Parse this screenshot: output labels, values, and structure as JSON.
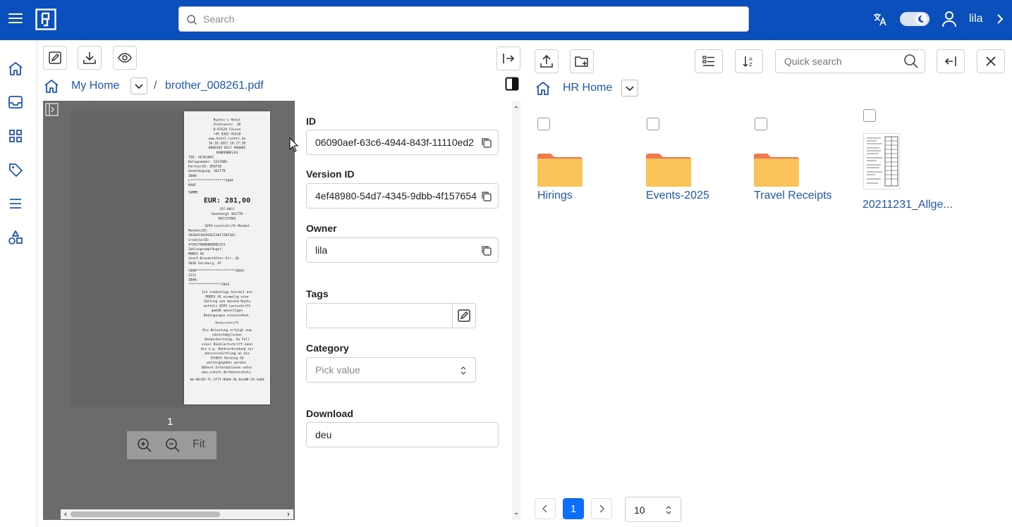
{
  "header": {
    "search_placeholder": "Search",
    "username": "lila"
  },
  "left_pane": {
    "breadcrumb": {
      "home": "My Home",
      "separator": "/",
      "file": "brother_008261.pdf"
    },
    "viewer": {
      "page_number": "1",
      "fit_label": "Fit"
    },
    "metadata": {
      "id_label": "ID",
      "id_value": "06090aef-63c6-4944-843f-11110ed2",
      "version_label": "Version ID",
      "version_value": "4ef48980-54d7-4345-9dbb-4f157654",
      "owner_label": "Owner",
      "owner_value": "lila",
      "tags_label": "Tags",
      "category_label": "Category",
      "category_placeholder": "Pick value",
      "download_label": "Download",
      "download_value": "deu"
    }
  },
  "right_pane": {
    "quick_search_placeholder": "Quick search",
    "breadcrumb_home": "HR Home",
    "items": [
      {
        "name": "Hirings",
        "type": "folder"
      },
      {
        "name": "Events-2025",
        "type": "folder"
      },
      {
        "name": "Travel Receipts",
        "type": "folder"
      },
      {
        "name": "20211231_Allge...",
        "type": "document"
      }
    ],
    "pagination": {
      "current_page": "1",
      "page_size": "10"
    }
  },
  "receipt_lines": [
    "Ruchti's Hotel",
    "Alatseestr. 38",
    "D-87629 Füssen",
    "+49 8362 91010",
    "www.hotel-ruchti.de",
    "16.10.2021    10:17:38",
    "0000165   0517   #00085",
    "KUNDENBELEG",
    "TID:          AE361065",
    "Belegnummer:   5317005",
    "PartnerID:     850718",
    "Genehmigung:   361T7B",
    "IBAN:",
    "L******************2044",
    "KAUF",
    "SUMME",
    "EUR: 281,00",
    "(EC:001)",
    "Genehmigt 361T7B",
    "001317003",
    "SEPA-Lastschrift-Mandat",
    "MandatsID:",
    "391045101#20211017285101",
    "CreditorID:",
    "4756270000000001253",
    "Zahlungsempfänger:",
    "MOBEX AG",
    "Josef-Brandstätter-Str. 2b",
    "5020 Salzburg, AT",
    "CDGM********************2044/",
    "2212",
    "IBAN:",
    "*****************2044",
    "Ich ermächtige hiermit die",
    "MOBEX AG einmalig eine",
    "Zahlung von meinem Konto",
    "mittels SEPA Lastschrift",
    "gemäß umseitigen",
    "Bedingungen einzuziehen.",
    "Unterschrift",
    "Die Belastung erfolgt zum",
    "nächstmöglichen",
    "Bankarbeitstag. Im Fall",
    "einer Rücklastschrift kann",
    "die o.g. Bankverbindung zur",
    "Adressermittlung an die",
    "SCHUFA Holding AG",
    "weitergegeben werden.",
    "Nähere Informationen unter",
    "www.schufa.de/datenschutz.",
    "bm-06/02-TL-1f7f-0d4d-3b-0ce00-33-1e8d"
  ],
  "icons": {
    "colors": {
      "brand": "#0b4fbd",
      "link": "#1d58b8",
      "folder": "#fbc45a",
      "folder_tab": "#f07a4c",
      "primary": "#0d6efd"
    }
  }
}
